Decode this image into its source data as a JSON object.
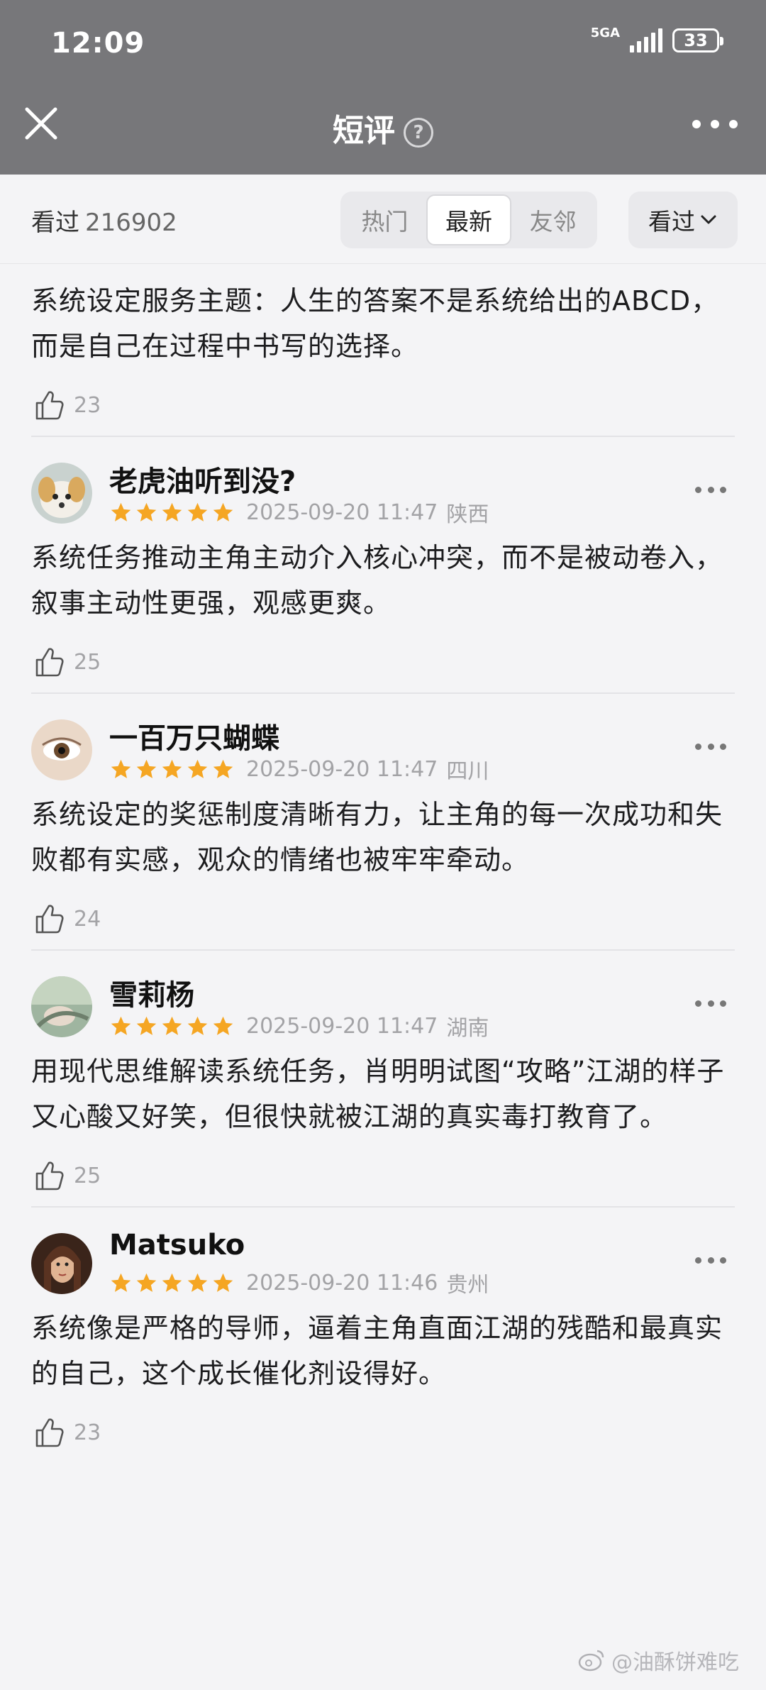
{
  "status_bar": {
    "time": "12:09",
    "network": "5GA",
    "battery": "33"
  },
  "nav": {
    "title": "短评",
    "help_glyph": "?"
  },
  "filter": {
    "seen_label": "看过",
    "seen_count": "216902",
    "tabs": [
      {
        "label": "热门",
        "active": false
      },
      {
        "label": "最新",
        "active": true
      },
      {
        "label": "友邻",
        "active": false
      }
    ],
    "sort_label": "看过"
  },
  "reviews": [
    {
      "user": "",
      "text": "系统设定服务主题：人生的答案不是系统给出的ABCD，而是自己在过程中书写的选择。",
      "likes": "23"
    },
    {
      "user": "老虎油听到没?",
      "rating": 5,
      "date": "2025-09-20 11:47",
      "location": "陕西",
      "text": "系统任务推动主角主动介入核心冲突，而不是被动卷入，叙事主动性更强，观感更爽。",
      "likes": "25"
    },
    {
      "user": "一百万只蝴蝶",
      "rating": 5,
      "date": "2025-09-20 11:47",
      "location": "四川",
      "text": "系统设定的奖惩制度清晰有力，让主角的每一次成功和失败都有实感，观众的情绪也被牢牢牵动。",
      "likes": "24"
    },
    {
      "user": "雪莉杨",
      "rating": 5,
      "date": "2025-09-20 11:47",
      "location": "湖南",
      "text": "用现代思维解读系统任务，肖明明试图“攻略”江湖的样子又心酸又好笑，但很快就被江湖的真实毒打教育了。",
      "likes": "25"
    },
    {
      "user": "Matsuko",
      "rating": 5,
      "date": "2025-09-20 11:46",
      "location": "贵州",
      "text": "系统像是严格的导师，逼着主角直面江湖的残酷和最真实的自己，这个成长催化剂设得好。",
      "likes": "23"
    }
  ],
  "watermark": "@油酥饼难吃",
  "colors": {
    "header_bg": "#77777a",
    "star": "#f5a623",
    "page_bg": "#f4f4f6"
  }
}
